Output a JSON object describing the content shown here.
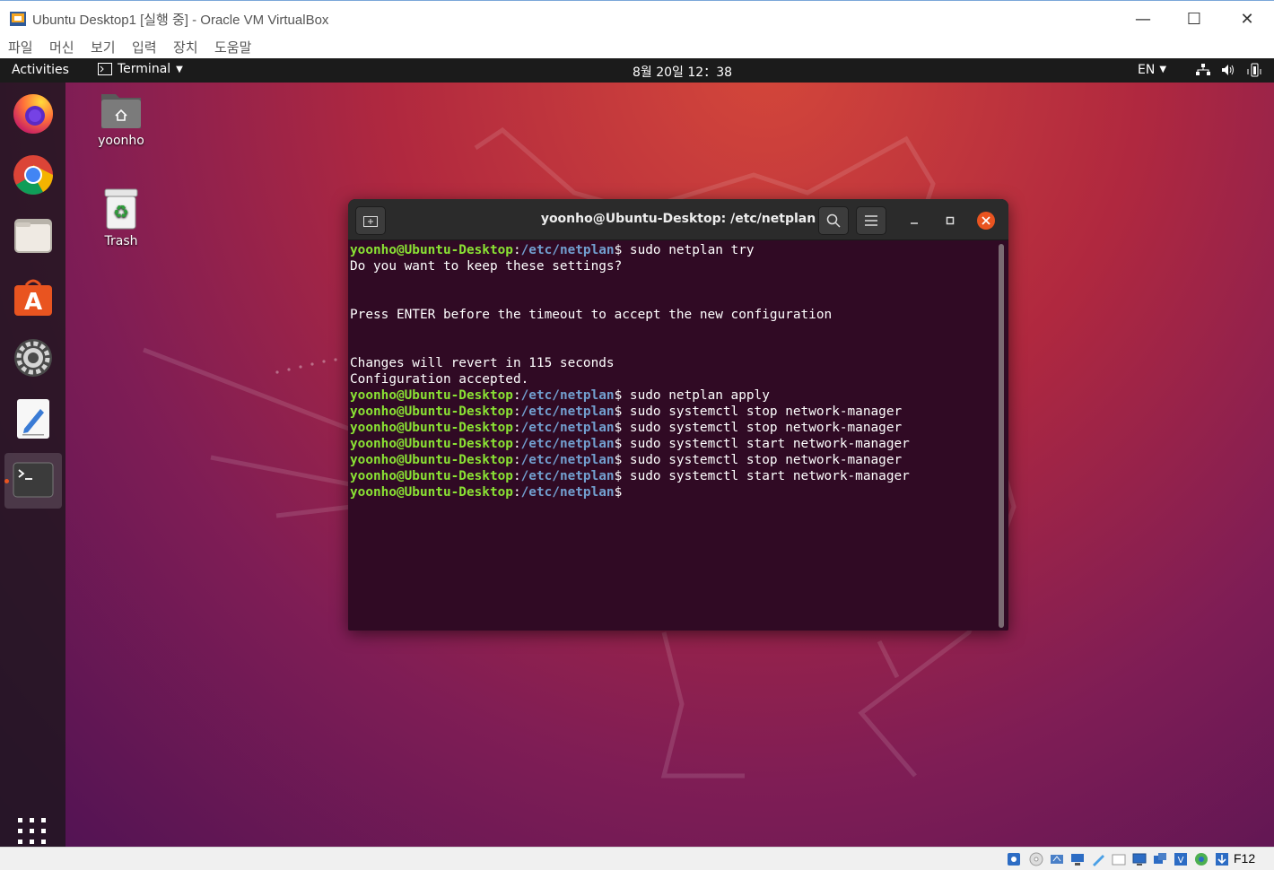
{
  "host_window": {
    "title": "Ubuntu Desktop1 [실행 중] - Oracle VM VirtualBox",
    "menu": [
      "파일",
      "머신",
      "보기",
      "입력",
      "장치",
      "도움말"
    ],
    "host_key_label": "F12"
  },
  "guest": {
    "topbar": {
      "activities": "Activities",
      "app_menu": "Terminal",
      "clock": "8월 20일  12：38",
      "input_method": "EN"
    },
    "dock": {
      "apps": [
        "firefox",
        "chrome",
        "files",
        "ubuntu-software",
        "settings",
        "text-editor",
        "terminal"
      ],
      "active_app": "terminal"
    },
    "desktop_icons": [
      {
        "label": "yoonho",
        "icon": "home-folder-icon"
      },
      {
        "label": "Trash",
        "icon": "trash-icon"
      }
    ],
    "terminal": {
      "title": "yoonho@Ubuntu-Desktop: /etc/netplan",
      "prompt_user": "yoonho@Ubuntu-Desktop",
      "prompt_path": "/etc/netplan",
      "lines": [
        {
          "type": "cmd",
          "text": " sudo netplan try"
        },
        {
          "type": "out",
          "text": "Do you want to keep these settings?"
        },
        {
          "type": "out",
          "text": ""
        },
        {
          "type": "out",
          "text": ""
        },
        {
          "type": "out",
          "text": "Press ENTER before the timeout to accept the new configuration"
        },
        {
          "type": "out",
          "text": ""
        },
        {
          "type": "out",
          "text": ""
        },
        {
          "type": "out",
          "text": "Changes will revert in 115 seconds"
        },
        {
          "type": "out",
          "text": "Configuration accepted."
        },
        {
          "type": "cmd",
          "text": " sudo netplan apply"
        },
        {
          "type": "cmd",
          "text": " sudo systemctl stop network-manager"
        },
        {
          "type": "cmd",
          "text": " sudo systemctl stop network-manager"
        },
        {
          "type": "cmd",
          "text": " sudo systemctl start network-manager"
        },
        {
          "type": "cmd",
          "text": " sudo systemctl stop network-manager"
        },
        {
          "type": "cmd",
          "text": " sudo systemctl start network-manager"
        },
        {
          "type": "cmd",
          "text": ""
        }
      ]
    }
  },
  "colors": {
    "ubuntu_orange": "#e95420",
    "terminal_bg": "#300a24",
    "prompt_user": "#8ae234",
    "prompt_path": "#729fcf"
  }
}
